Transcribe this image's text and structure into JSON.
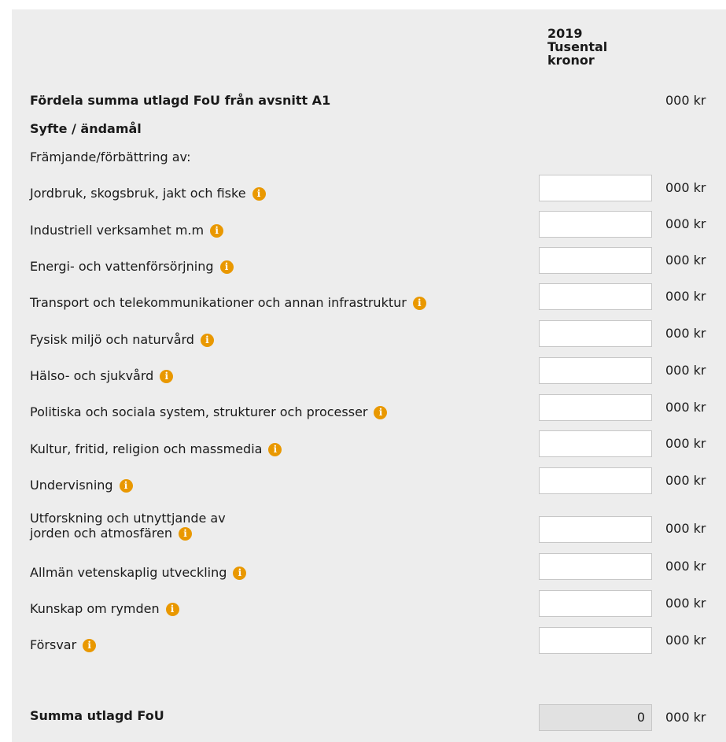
{
  "header": {
    "year": "2019",
    "line2": "Tusental",
    "line3": "kronor"
  },
  "section_title": "Fördela summa utlagd FoU från avsnitt A1",
  "section_unit": "000 kr",
  "subtitle": "Syfte / ändamål",
  "intro": "Främjande/förbättring av:",
  "unit_label": "000 kr",
  "info_icon": "i",
  "colors": {
    "info_icon": "#e99800",
    "panel": "#ededed",
    "sum_field": "#e1e1e1"
  },
  "rows": [
    {
      "label": "Jordbruk, skogsbruk, jakt och fiske",
      "value": ""
    },
    {
      "label": "Industriell verksamhet m.m",
      "value": ""
    },
    {
      "label": "Energi- och vattenförsörjning",
      "value": ""
    },
    {
      "label": "Transport och telekommunikationer och annan infrastruktur",
      "value": ""
    },
    {
      "label": "Fysisk miljö och naturvård",
      "value": ""
    },
    {
      "label": "Hälso- och sjukvård",
      "value": ""
    },
    {
      "label": "Politiska och sociala system, strukturer och processer",
      "value": ""
    },
    {
      "label": "Kultur, fritid, religion och massmedia",
      "value": ""
    },
    {
      "label": "Undervisning",
      "value": ""
    },
    {
      "label_line1": "Utforskning och utnyttjande av",
      "label_line2": "jorden och atmosfären",
      "value": ""
    },
    {
      "label": "Allmän vetenskaplig utveckling",
      "value": ""
    },
    {
      "label": "Kunskap om rymden",
      "value": ""
    },
    {
      "label": "Försvar",
      "value": ""
    }
  ],
  "sum": {
    "label": "Summa utlagd FoU",
    "value": "0",
    "unit": "000 kr"
  }
}
